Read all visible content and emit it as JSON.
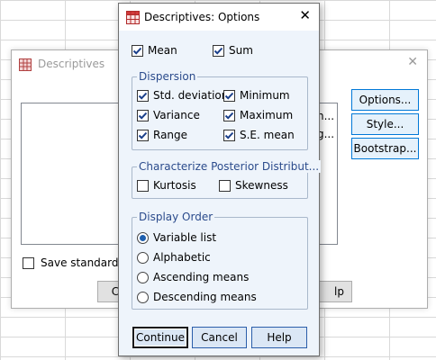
{
  "background_dialog": {
    "title": "Descriptives",
    "list_right_fragments": [
      "n...",
      "g..."
    ],
    "side_buttons": [
      "Options...",
      "Style...",
      "Bootstrap..."
    ],
    "save_label": "Save standardize",
    "bottom_left_fragment": "C",
    "bottom_right_fragment": "lp"
  },
  "options_dialog": {
    "title": "Descriptives: Options",
    "top_checks": [
      {
        "label": "Mean",
        "checked": true
      },
      {
        "label": "Sum",
        "checked": true
      }
    ],
    "dispersion": {
      "label": "Dispersion",
      "left": [
        {
          "label": "Std. deviation",
          "checked": true
        },
        {
          "label": "Variance",
          "checked": true
        },
        {
          "label": "Range",
          "checked": true
        }
      ],
      "right": [
        {
          "label": "Minimum",
          "checked": true
        },
        {
          "label": "Maximum",
          "checked": true
        },
        {
          "label": "S.E. mean",
          "checked": true
        }
      ]
    },
    "posterior": {
      "label": "Characterize Posterior Distribut...",
      "items": [
        {
          "label": "Kurtosis",
          "checked": false
        },
        {
          "label": "Skewness",
          "checked": false
        }
      ]
    },
    "display_order": {
      "label": "Display Order",
      "options": [
        {
          "label": "Variable list",
          "selected": true
        },
        {
          "label": "Alphabetic",
          "selected": false
        },
        {
          "label": "Ascending means",
          "selected": false
        },
        {
          "label": "Descending means",
          "selected": false
        }
      ]
    },
    "buttons": {
      "continue": "Continue",
      "cancel": "Cancel",
      "help": "Help"
    }
  }
}
